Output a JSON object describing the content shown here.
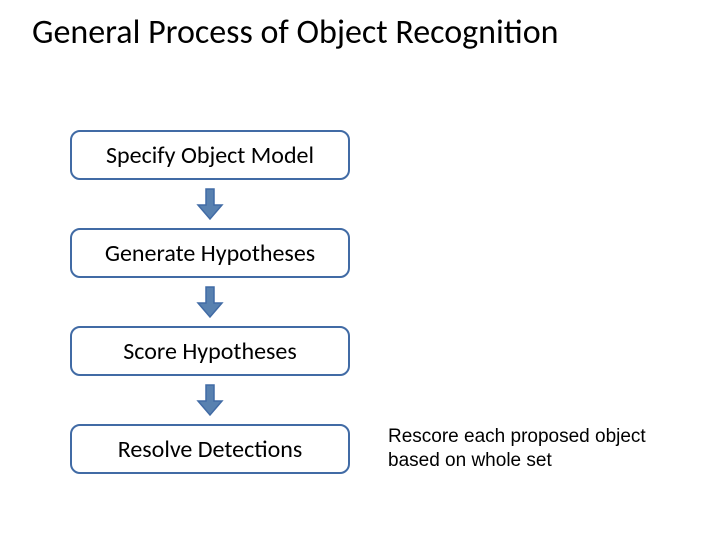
{
  "title": "General Process of Object Recognition",
  "steps": [
    {
      "label": "Specify Object Model"
    },
    {
      "label": "Generate Hypotheses"
    },
    {
      "label": "Score Hypotheses"
    },
    {
      "label": "Resolve Detections"
    }
  ],
  "annotation": "Rescore each proposed object based on whole set",
  "colors": {
    "box_border": "#416ba5",
    "arrow_fill": "#5881b0",
    "arrow_stroke": "#416ba5"
  }
}
